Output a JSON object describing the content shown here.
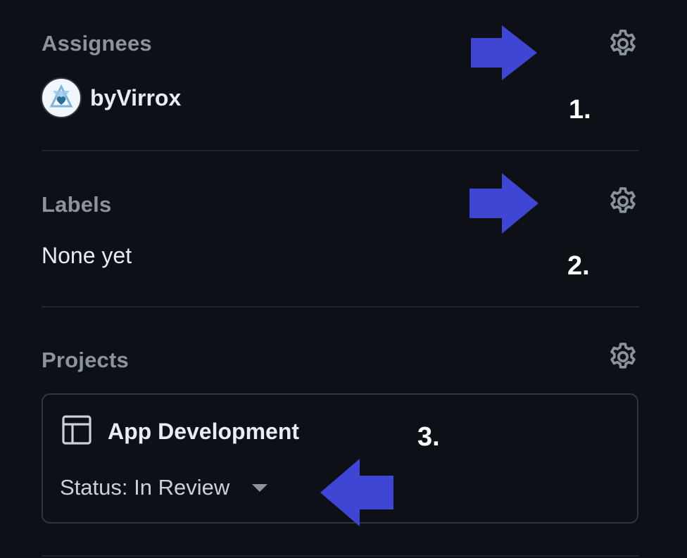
{
  "colors": {
    "background": "#0d1117",
    "muted_text": "#8b949e",
    "primary_text": "#e6edf3",
    "border": "#30363d",
    "annotation_arrow": "#4046d4"
  },
  "assignees": {
    "title": "Assignees",
    "settings_icon": "gear-icon",
    "users": [
      {
        "name": "byVirrox",
        "avatar": "avatar-icon"
      }
    ]
  },
  "labels": {
    "title": "Labels",
    "settings_icon": "gear-icon",
    "empty_text": "None yet"
  },
  "projects": {
    "title": "Projects",
    "settings_icon": "gear-icon",
    "items": [
      {
        "icon": "table-icon",
        "name": "App Development",
        "status_text": "Status: In Review",
        "dropdown_icon": "caret-down-icon"
      }
    ]
  },
  "annotations": {
    "marker_1": "1.",
    "marker_2": "2.",
    "marker_3": "3."
  }
}
